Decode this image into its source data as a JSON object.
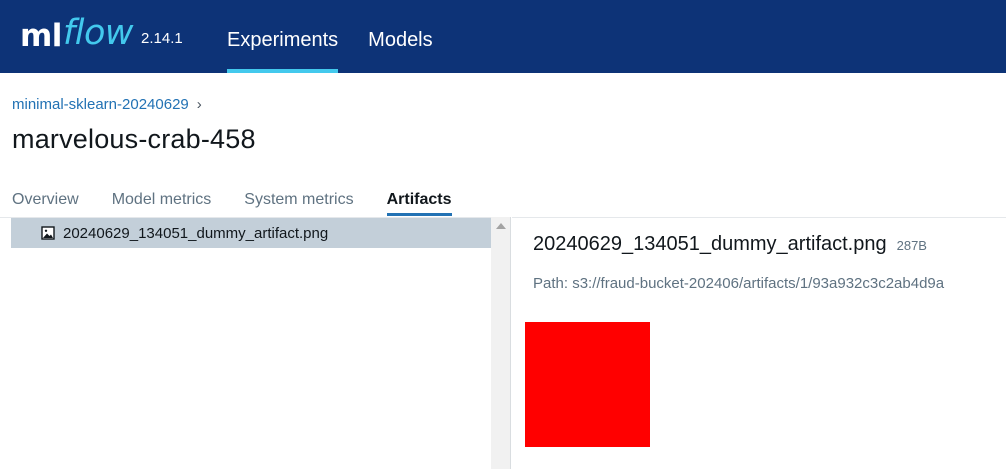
{
  "header": {
    "logo_ml": "ml",
    "logo_flow": "flow",
    "version": "2.14.1",
    "nav": [
      {
        "label": "Experiments",
        "active": true
      },
      {
        "label": "Models",
        "active": false
      }
    ],
    "background_color": "#0d3377",
    "accent_color": "#43c9ed"
  },
  "breadcrumb": {
    "experiment": "minimal-sklearn-20240629",
    "separator": "›"
  },
  "run": {
    "title": "marvelous-crab-458"
  },
  "tabs": [
    {
      "label": "Overview",
      "active": false
    },
    {
      "label": "Model metrics",
      "active": false
    },
    {
      "label": "System metrics",
      "active": false
    },
    {
      "label": "Artifacts",
      "active": true
    }
  ],
  "artifacts": {
    "tree": [
      {
        "name": "20240629_134051_dummy_artifact.png",
        "icon": "image-file-icon",
        "selected": true
      }
    ],
    "detail": {
      "filename": "20240629_134051_dummy_artifact.png",
      "size": "287B",
      "path": "Path: s3://fraud-bucket-202406/artifacts/1/93a932c3c2ab4d9a",
      "preview_color": "#ff0000"
    }
  }
}
